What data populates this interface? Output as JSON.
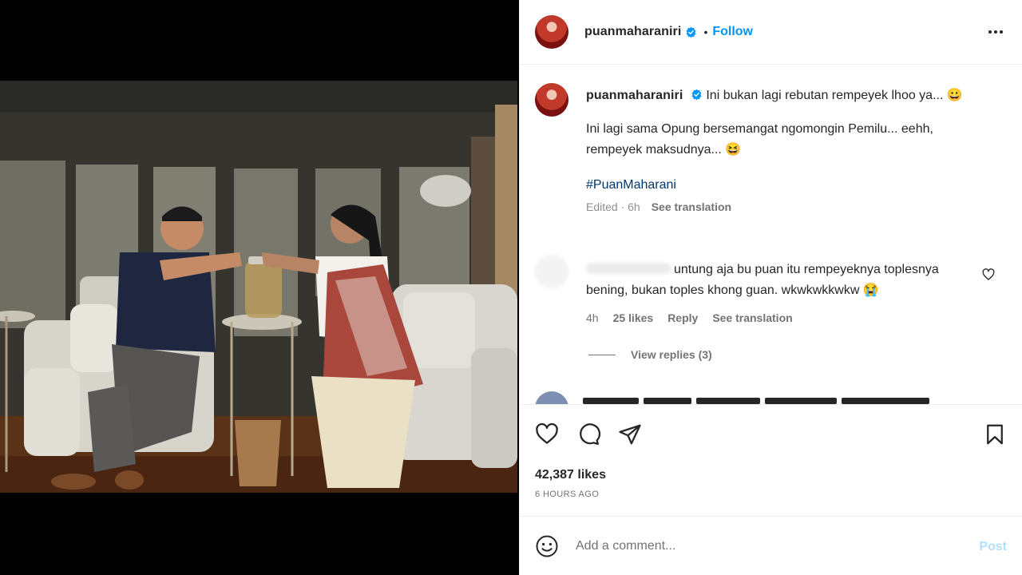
{
  "post": {
    "username": "puanmaharaniri",
    "dot": "•",
    "follow_label": "Follow",
    "caption_title": "Ini bukan lagi rebutan rempeyek lhoo ya... 😀",
    "caption_line2": "Ini lagi sama Opung bersemangat ngomongin Pemilu... eehh,",
    "caption_line3": "rempeyek maksudnya... 😆",
    "hashtag": "#PuanMaharani",
    "edited": "Edited · 6h",
    "see_translation": "See translation"
  },
  "comment": {
    "line1": "untung aja bu puan itu rempeyeknya toplesnya",
    "line2": "bening, bukan toples khong guan. wkwkwkkwkw 😭",
    "time": "4h",
    "likes": "25 likes",
    "reply": "Reply",
    "see_translation": "See translation",
    "view_replies": "View replies (3)"
  },
  "footer": {
    "likes": "42,387 likes",
    "time_ago": "6 HOURS AGO",
    "comment_placeholder": "Add a comment...",
    "post_label": "Post"
  },
  "icons": {
    "verified": "verified-badge-icon",
    "more": "more-options-icon",
    "like": "heart-icon",
    "comment": "comment-icon",
    "share": "share-icon",
    "save": "bookmark-icon",
    "emoji": "emoji-icon"
  },
  "colors": {
    "accent": "#0095f6",
    "post_disabled": "#b2dffc",
    "hashtag": "#00376b"
  }
}
